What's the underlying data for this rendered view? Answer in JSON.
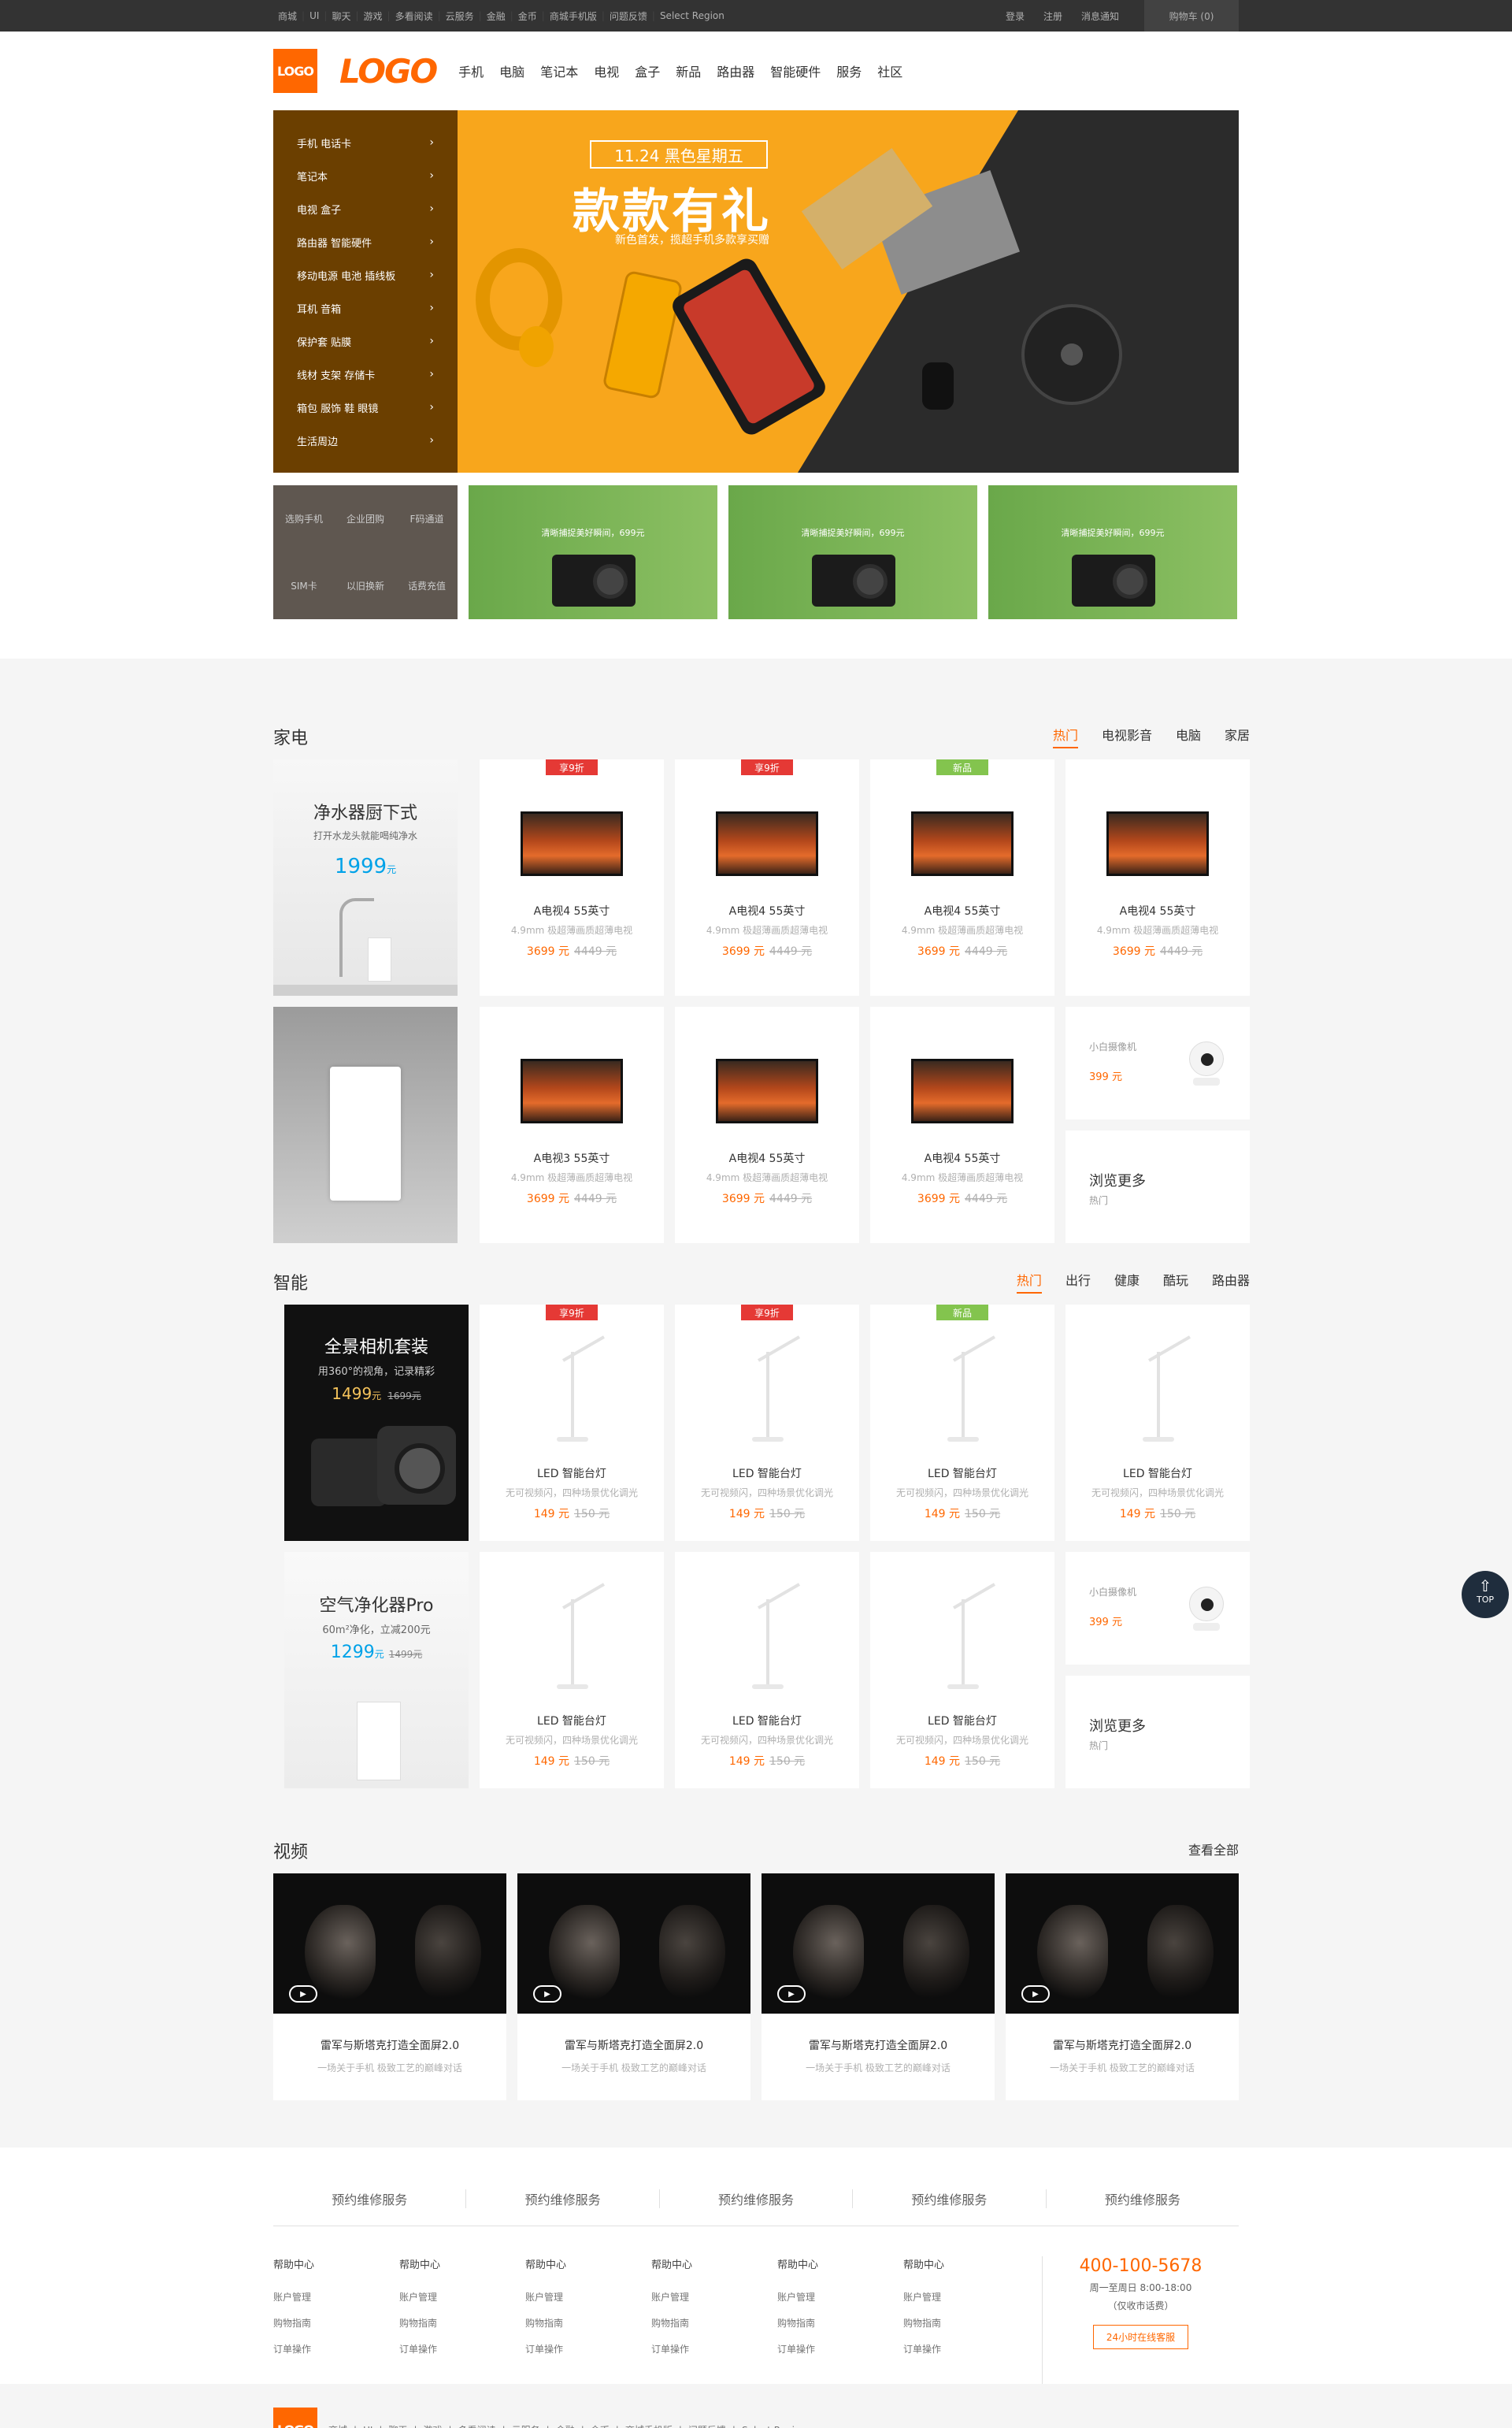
{
  "topbar": {
    "links": [
      "商城",
      "UI",
      "聊天",
      "游戏",
      "多看阅读",
      "云服务",
      "金融",
      "金币",
      "商城手机版",
      "问题反馈",
      "Select Region"
    ],
    "login": "登录",
    "register": "注册",
    "notice": "消息通知",
    "cart": "购物车 (0)"
  },
  "header": {
    "logo_mark": "LOGO",
    "logo_word": "LOGO",
    "nav": [
      "手机",
      "电脑",
      "笔记本",
      "电视",
      "盒子",
      "新品",
      "路由器",
      "智能硬件",
      "服务",
      "社区"
    ]
  },
  "hero": {
    "categories": [
      "手机 电话卡",
      "笔记本",
      "电视 盒子",
      "路由器 智能硬件",
      "移动电源 电池 插线板",
      "耳机 音箱",
      "保护套 贴膜",
      "线材 支架 存储卡",
      "箱包 服饰 鞋 眼镜",
      "生活周边"
    ],
    "banner_tag": "11.24 黑色星期五",
    "banner_headline": "款款有礼",
    "banner_sub": "新色首发，揽超手机多款享买赠",
    "quick": [
      "选购手机",
      "企业团购",
      "F码通道",
      "SIM卡",
      "以旧换新",
      "话费充值"
    ],
    "promo_text": "清晰捕捉美好瞬间，699元"
  },
  "appliances": {
    "title": "家电",
    "tabs": [
      "热门",
      "电视影音",
      "电脑",
      "家居"
    ],
    "promo1": {
      "title": "净水器厨下式",
      "sub": "打开水龙头就能喝纯净水",
      "price": "1999",
      "unit": "元"
    },
    "cards": [
      {
        "flag": "享9折",
        "flag_color": "#e53935",
        "name": "A电视4 55英寸",
        "desc": "4.9mm 极超薄画质超薄电视",
        "price": "3699 元",
        "old": "4449 元"
      },
      {
        "flag": "享9折",
        "flag_color": "#e53935",
        "name": "A电视4 55英寸",
        "desc": "4.9mm 极超薄画质超薄电视",
        "price": "3699 元",
        "old": "4449 元"
      },
      {
        "flag": "新品",
        "flag_color": "#83c44e",
        "name": "A电视4 55英寸",
        "desc": "4.9mm 极超薄画质超薄电视",
        "price": "3699 元",
        "old": "4449 元"
      },
      {
        "flag": "",
        "name": "A电视4 55英寸",
        "desc": "4.9mm 极超薄画质超薄电视",
        "price": "3699 元",
        "old": "4449 元"
      },
      {
        "flag": "",
        "name": "A电视3 55英寸",
        "desc": "4.9mm 极超薄画质超薄电视",
        "price": "3699 元",
        "old": "4449 元"
      },
      {
        "flag": "",
        "name": "A电视4 55英寸",
        "desc": "4.9mm 极超薄画质超薄电视",
        "price": "3699 元",
        "old": "4449 元"
      },
      {
        "flag": "",
        "name": "A电视4 55英寸",
        "desc": "4.9mm 极超薄画质超薄电视",
        "price": "3699 元",
        "old": "4449 元"
      }
    ],
    "small": {
      "name": "小白摄像机",
      "price": "399 元"
    },
    "more": {
      "title": "浏览更多",
      "sub": "热门"
    }
  },
  "smart": {
    "title": "智能",
    "tabs": [
      "热门",
      "出行",
      "健康",
      "酷玩",
      "路由器"
    ],
    "promo1": {
      "title": "全景相机套装",
      "sub": "用360°的视角，记录精彩",
      "price": "1499",
      "unit": "元",
      "old": "1699元"
    },
    "promo2": {
      "title": "空气净化器Pro",
      "sub": "60m²净化，立减200元",
      "price": "1299",
      "unit": "元",
      "old": "1499元"
    },
    "cards": [
      {
        "flag": "享9折",
        "flag_color": "#e53935",
        "name": "LED 智能台灯",
        "desc": "无可视频闪，四种场景优化调光",
        "price": "149 元",
        "old": "150 元"
      },
      {
        "flag": "享9折",
        "flag_color": "#e53935",
        "name": "LED 智能台灯",
        "desc": "无可视频闪，四种场景优化调光",
        "price": "149 元",
        "old": "150 元"
      },
      {
        "flag": "新品",
        "flag_color": "#83c44e",
        "name": "LED 智能台灯",
        "desc": "无可视频闪，四种场景优化调光",
        "price": "149 元",
        "old": "150 元"
      },
      {
        "flag": "",
        "name": "LED 智能台灯",
        "desc": "无可视频闪，四种场景优化调光",
        "price": "149 元",
        "old": "150 元"
      },
      {
        "flag": "",
        "name": "LED 智能台灯",
        "desc": "无可视频闪，四种场景优化调光",
        "price": "149 元",
        "old": "150 元"
      },
      {
        "flag": "",
        "name": "LED 智能台灯",
        "desc": "无可视频闪，四种场景优化调光",
        "price": "149 元",
        "old": "150 元"
      },
      {
        "flag": "",
        "name": "LED 智能台灯",
        "desc": "无可视频闪，四种场景优化调光",
        "price": "149 元",
        "old": "150 元"
      }
    ],
    "small": {
      "name": "小白摄像机",
      "price": "399 元"
    },
    "more": {
      "title": "浏览更多",
      "sub": "热门"
    }
  },
  "video": {
    "title": "视频",
    "view_all": "查看全部",
    "items": [
      {
        "title": "雷军与斯塔克打造全面屏2.0",
        "desc": "一场关于手机 极致工艺的巅峰对话"
      },
      {
        "title": "雷军与斯塔克打造全面屏2.0",
        "desc": "一场关于手机 极致工艺的巅峰对话"
      },
      {
        "title": "雷军与斯塔克打造全面屏2.0",
        "desc": "一场关于手机 极致工艺的巅峰对话"
      },
      {
        "title": "雷军与斯塔克打造全面屏2.0",
        "desc": "一场关于手机 极致工艺的巅峰对话"
      }
    ]
  },
  "totop": "TOP",
  "footer": {
    "services": [
      "预约维修服务",
      "预约维修服务",
      "预约维修服务",
      "预约维修服务",
      "预约维修服务"
    ],
    "cols": [
      {
        "head": "帮助中心",
        "links": [
          "账户管理",
          "购物指南",
          "订单操作"
        ]
      },
      {
        "head": "帮助中心",
        "links": [
          "账户管理",
          "购物指南",
          "订单操作"
        ]
      },
      {
        "head": "帮助中心",
        "links": [
          "账户管理",
          "购物指南",
          "订单操作"
        ]
      },
      {
        "head": "帮助中心",
        "links": [
          "账户管理",
          "购物指南",
          "订单操作"
        ]
      },
      {
        "head": "帮助中心",
        "links": [
          "账户管理",
          "购物指南",
          "订单操作"
        ]
      },
      {
        "head": "帮助中心",
        "links": [
          "账户管理",
          "购物指南",
          "订单操作"
        ]
      }
    ],
    "tel": "400-100-5678",
    "hours": "周一至周日 8:00-18:00",
    "fee": "（仅收市话费）",
    "service_btn": "24小时在线客服"
  },
  "bottom": {
    "logo": "LOGO",
    "links": [
      "商城",
      "UI",
      "聊天",
      "游戏",
      "多看阅读",
      "云服务",
      "金融",
      "金币",
      "商城手机版",
      "问题反馈",
      "Select Region"
    ]
  }
}
